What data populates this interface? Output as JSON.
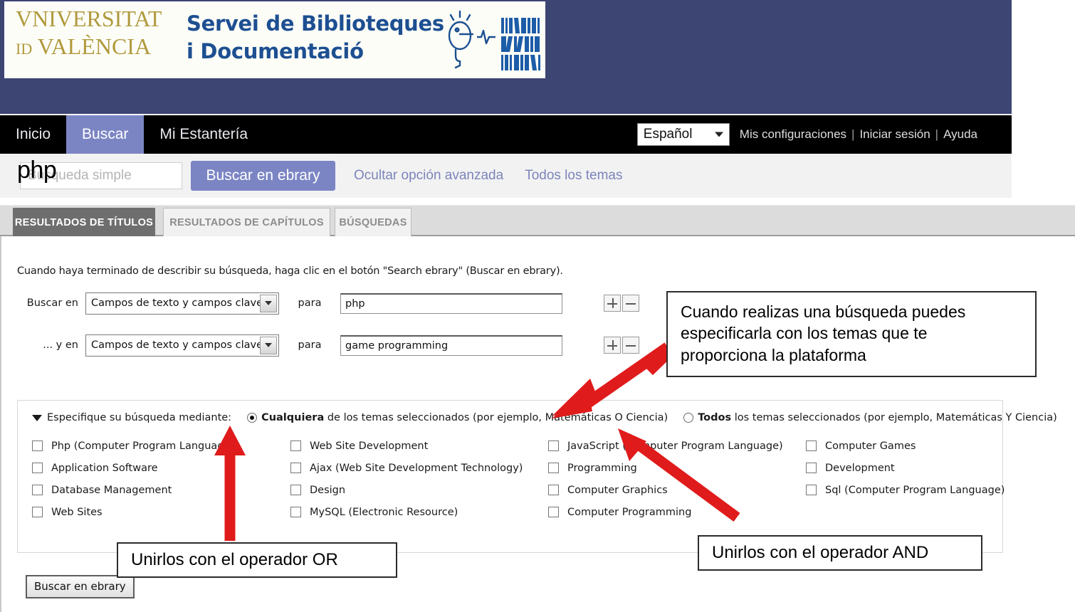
{
  "header": {
    "university_line1": "VNIVERSITAT",
    "university_line2_prefix": "ID",
    "university_line2": "VALÈNCIA",
    "service_line1": "Servei de Biblioteques",
    "service_line2": "i Documentació",
    "band_color": "#3d4573",
    "logo_text_color": "#1d4f91",
    "university_text_color": "#b09a3e"
  },
  "nav": {
    "tabs": [
      {
        "label": "Inicio",
        "active": false
      },
      {
        "label": "Buscar",
        "active": true
      },
      {
        "label": "Mi Estantería",
        "active": false
      }
    ],
    "language_selected": "Español",
    "links": [
      "Mis configuraciones",
      "Iniciar sesión",
      "Ayuda"
    ],
    "separator": "|",
    "active_tab_color": "#7b85c4"
  },
  "searchbar": {
    "simple_placeholder": "Búsqueda simple",
    "simple_value": "",
    "overlay_annotation": "php",
    "search_button": "Buscar en ebrary",
    "hide_advanced_link": "Ocultar opción avanzada",
    "all_topics_link": "Todos los temas",
    "button_color": "#7b85c4",
    "link_color": "#7c85bb"
  },
  "result_tabs": [
    {
      "label": "RESULTADOS DE TÍTULOS",
      "selected": true
    },
    {
      "label": "RESULTADOS DE CAPÍTULOS",
      "selected": false
    },
    {
      "label": "BÚSQUEDAS",
      "selected": false
    }
  ],
  "advanced_search": {
    "hint": "Cuando haya terminado de describir su búsqueda, haga clic en el botón \"Search ebrary\" (Buscar en ebrary).",
    "rows": [
      {
        "label": "Buscar en",
        "field_selected": "Campos de texto y campos clave",
        "para_label": "para",
        "query_value": "php",
        "add_button": "+",
        "remove_button": "−"
      },
      {
        "label": "... y en",
        "field_selected": "Campos de texto y campos clave",
        "para_label": "para",
        "query_value": "game programming",
        "add_button": "+",
        "remove_button": "−"
      }
    ],
    "submit_button": "Buscar en ebrary"
  },
  "topics": {
    "heading": "Especifique su búsqueda mediante:",
    "radios": [
      {
        "bold": "Cualquiera",
        "rest": " de los temas seleccionados (por ejemplo, Matemáticas O Ciencia)",
        "selected": true
      },
      {
        "bold": "Todos",
        "rest": " los temas seleccionados (por ejemplo, Matemáticas Y Ciencia)",
        "selected": false
      }
    ],
    "columns": [
      [
        "Php (Computer Program Language)",
        "Application Software",
        "Database Management",
        "Web Sites"
      ],
      [
        "Web Site Development",
        "Ajax (Web Site Development Technology)",
        "Design",
        "MySQL (Electronic Resource)"
      ],
      [
        "JavaScript (Computer Program Language)",
        "Programming",
        "Computer Graphics",
        "Computer Programming"
      ],
      [
        "Computer Games",
        "Development",
        "Sql (Computer Program Language)"
      ]
    ]
  },
  "annotations": {
    "topics_note_line1": "Cuando realizas una búsqueda puedes",
    "topics_note_line2": "especificarla con los temas que te",
    "topics_note_line3": "proporciona la plataforma",
    "or_note": "Unirlos con el operador OR",
    "and_note": "Unirlos con el operador AND",
    "arrow_color": "#e01b1b"
  }
}
